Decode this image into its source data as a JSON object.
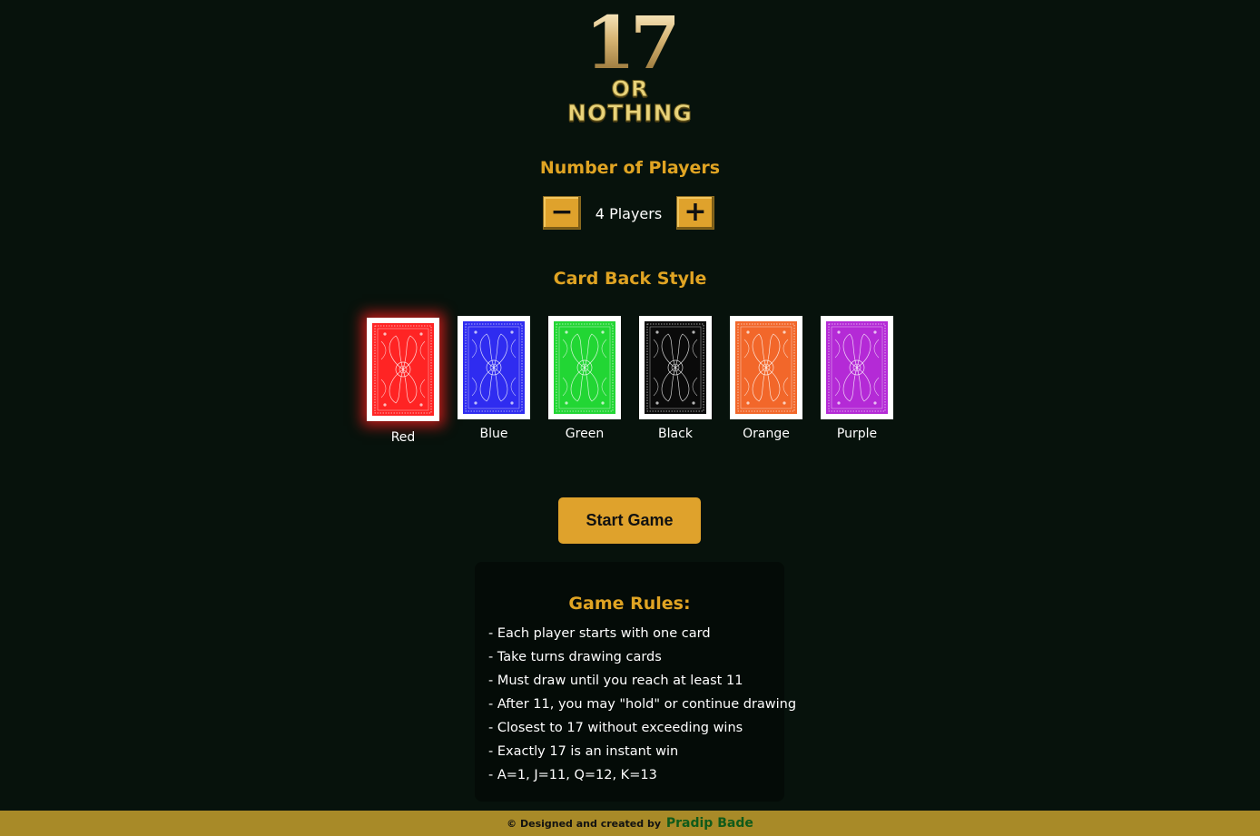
{
  "logo": {
    "number": "17",
    "or": "OR",
    "nothing": "NOTHING"
  },
  "players": {
    "title": "Number of Players",
    "minus_label": "−",
    "plus_label": "+",
    "value_text": "4 Players",
    "count": 4
  },
  "card_style": {
    "title": "Card Back Style",
    "selected": "Red",
    "options": [
      {
        "label": "Red",
        "color": "#ff2424"
      },
      {
        "label": "Blue",
        "color": "#2f2cf0"
      },
      {
        "label": "Green",
        "color": "#22d634"
      },
      {
        "label": "Black",
        "color": "#0a0a0a"
      },
      {
        "label": "Orange",
        "color": "#f2672a"
      },
      {
        "label": "Purple",
        "color": "#b42ad6"
      }
    ]
  },
  "start_button": {
    "label": "Start Game"
  },
  "rules": {
    "title": "Game Rules:",
    "items": [
      "- Each player starts with one card",
      "- Take turns drawing cards",
      "- Must draw until you reach at least 11",
      "- After 11, you may \"hold\" or continue drawing",
      "- Closest to 17 without exceeding wins",
      "- Exactly 17 is an instant win",
      "- A=1, J=11, Q=12, K=13"
    ]
  },
  "footer": {
    "text": "© Designed and created by",
    "author": "Pradip Bade"
  },
  "colors": {
    "background": "#07120c",
    "accent_gold": "#dfa22c",
    "footer_bg": "#a88a28",
    "author_green": "#0f5a1a"
  }
}
